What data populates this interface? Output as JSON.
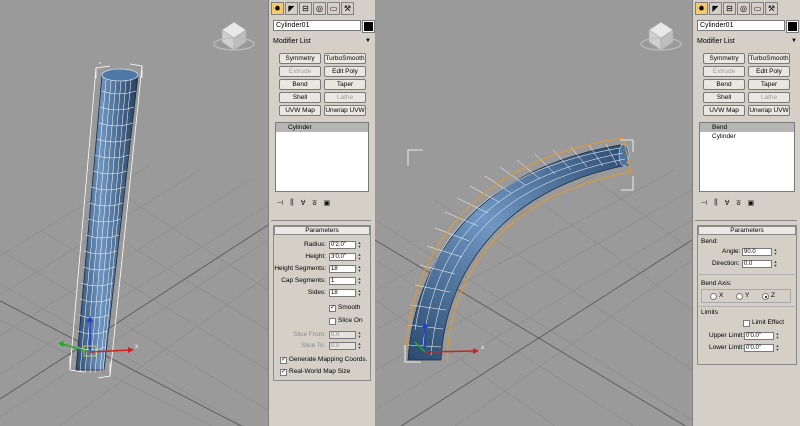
{
  "left_panel": {
    "tabs": [
      {
        "icon": "sun-icon",
        "glyph": "✹",
        "active": true
      },
      {
        "icon": "modify-icon",
        "glyph": "◤"
      },
      {
        "icon": "hierarchy-icon",
        "glyph": "⊟"
      },
      {
        "icon": "motion-icon",
        "glyph": "◎"
      },
      {
        "icon": "display-icon",
        "glyph": "▭"
      },
      {
        "icon": "utilities-icon",
        "glyph": "⚒"
      }
    ],
    "object_name": "Cylinder01",
    "modifier_list": "Modifier List",
    "modifier_buttons": [
      {
        "label": "Symmetry",
        "disabled": false
      },
      {
        "label": "TurboSmooth",
        "disabled": false
      },
      {
        "label": "Extrude",
        "disabled": true
      },
      {
        "label": "Edit Poly",
        "disabled": false
      },
      {
        "label": "Bend",
        "disabled": false
      },
      {
        "label": "Taper",
        "disabled": false
      },
      {
        "label": "Shell",
        "disabled": false
      },
      {
        "label": "Lathe",
        "disabled": true
      },
      {
        "label": "UVW Map",
        "disabled": false
      },
      {
        "label": "Unwrap UVW",
        "disabled": false
      }
    ],
    "stack": [
      "Cylinder"
    ],
    "rollout_title": "Parameters",
    "params": [
      {
        "label": "Radius:",
        "value": "0'2.0\"",
        "disabled": false
      },
      {
        "label": "Height:",
        "value": "3'0.0\"",
        "disabled": false
      },
      {
        "label": "Height Segments:",
        "value": "18",
        "disabled": false
      },
      {
        "label": "Cap Segments:",
        "value": "1",
        "disabled": false
      },
      {
        "label": "Sides:",
        "value": "18",
        "disabled": false
      }
    ],
    "smooth_label": "Smooth",
    "slice_on_label": "Slice On",
    "slice_from_label": "Slice From:",
    "slice_from_value": "0.0",
    "slice_to_label": "Slice To:",
    "slice_to_value": "0.0",
    "gen_mapping_label": "Generate Mapping Coords.",
    "real_world_label": "Real-World Map Size"
  },
  "right_panel": {
    "tabs": [
      {
        "icon": "sun-icon",
        "glyph": "✹",
        "active": true
      },
      {
        "icon": "modify-icon",
        "glyph": "◤"
      },
      {
        "icon": "hierarchy-icon",
        "glyph": "⊟"
      },
      {
        "icon": "motion-icon",
        "glyph": "◎"
      },
      {
        "icon": "display-icon",
        "glyph": "▭"
      },
      {
        "icon": "utilities-icon",
        "glyph": "⚒"
      }
    ],
    "object_name": "Cylinder01",
    "modifier_list": "Modifier List",
    "modifier_buttons": [
      {
        "label": "Symmetry",
        "disabled": false
      },
      {
        "label": "TurboSmooth",
        "disabled": false
      },
      {
        "label": "Extrude",
        "disabled": true
      },
      {
        "label": "Edit Poly",
        "disabled": false
      },
      {
        "label": "Bend",
        "disabled": false
      },
      {
        "label": "Taper",
        "disabled": false
      },
      {
        "label": "Shell",
        "disabled": false
      },
      {
        "label": "Lathe",
        "disabled": true
      },
      {
        "label": "UVW Map",
        "disabled": false
      },
      {
        "label": "Unwrap UVW",
        "disabled": false
      }
    ],
    "stack": [
      "Bend",
      "Cylinder"
    ],
    "rollout_title": "Parameters",
    "bend_label": "Bend:",
    "angle_label": "Angle:",
    "angle_value": "90.0",
    "direction_label": "Direction:",
    "direction_value": "0.0",
    "bend_axis_label": "Bend Axis:",
    "axes": [
      "X",
      "Y",
      "Z"
    ],
    "selected_axis": "Z",
    "limits_label": "Limits",
    "limit_effect_label": "Limit Effect",
    "upper_limit_label": "Upper Limit:",
    "upper_limit_value": "0'0.0\"",
    "lower_limit_label": "Lower Limit:",
    "lower_limit_value": "0'0.0\""
  },
  "viewport_left": {
    "selection_color": "#ffffff",
    "bg": "#9a9a9a"
  },
  "viewport_right": {
    "selection_color": "#ffffff",
    "bg": "#9a9a9a"
  },
  "colors": {
    "cylinder_blue": "#3f6691",
    "highlight_orange": "#f6c96a"
  }
}
